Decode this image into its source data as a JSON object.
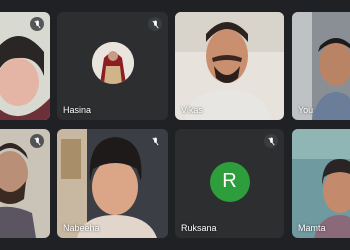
{
  "meeting": {
    "colors": {
      "background": "#202124",
      "tile": "#3c4043",
      "avatar_r": "#2e9e3c",
      "hasina_tile": "#2d2e30",
      "ruksana_tile": "#2d2e30"
    },
    "tiles": [
      {
        "name": "",
        "muted": true,
        "media": "video"
      },
      {
        "name": "Hasina",
        "muted": true,
        "media": "avatar-photo"
      },
      {
        "name": "Vikas",
        "muted": false,
        "media": "video"
      },
      {
        "name": "You",
        "muted": false,
        "media": "video"
      },
      {
        "name": "",
        "muted": true,
        "media": "video"
      },
      {
        "name": "Nabeeha",
        "muted": true,
        "media": "video"
      },
      {
        "name": "Ruksana",
        "muted": true,
        "media": "avatar-letter",
        "avatar_letter": "R"
      },
      {
        "name": "Mamta",
        "muted": false,
        "media": "video"
      }
    ]
  }
}
